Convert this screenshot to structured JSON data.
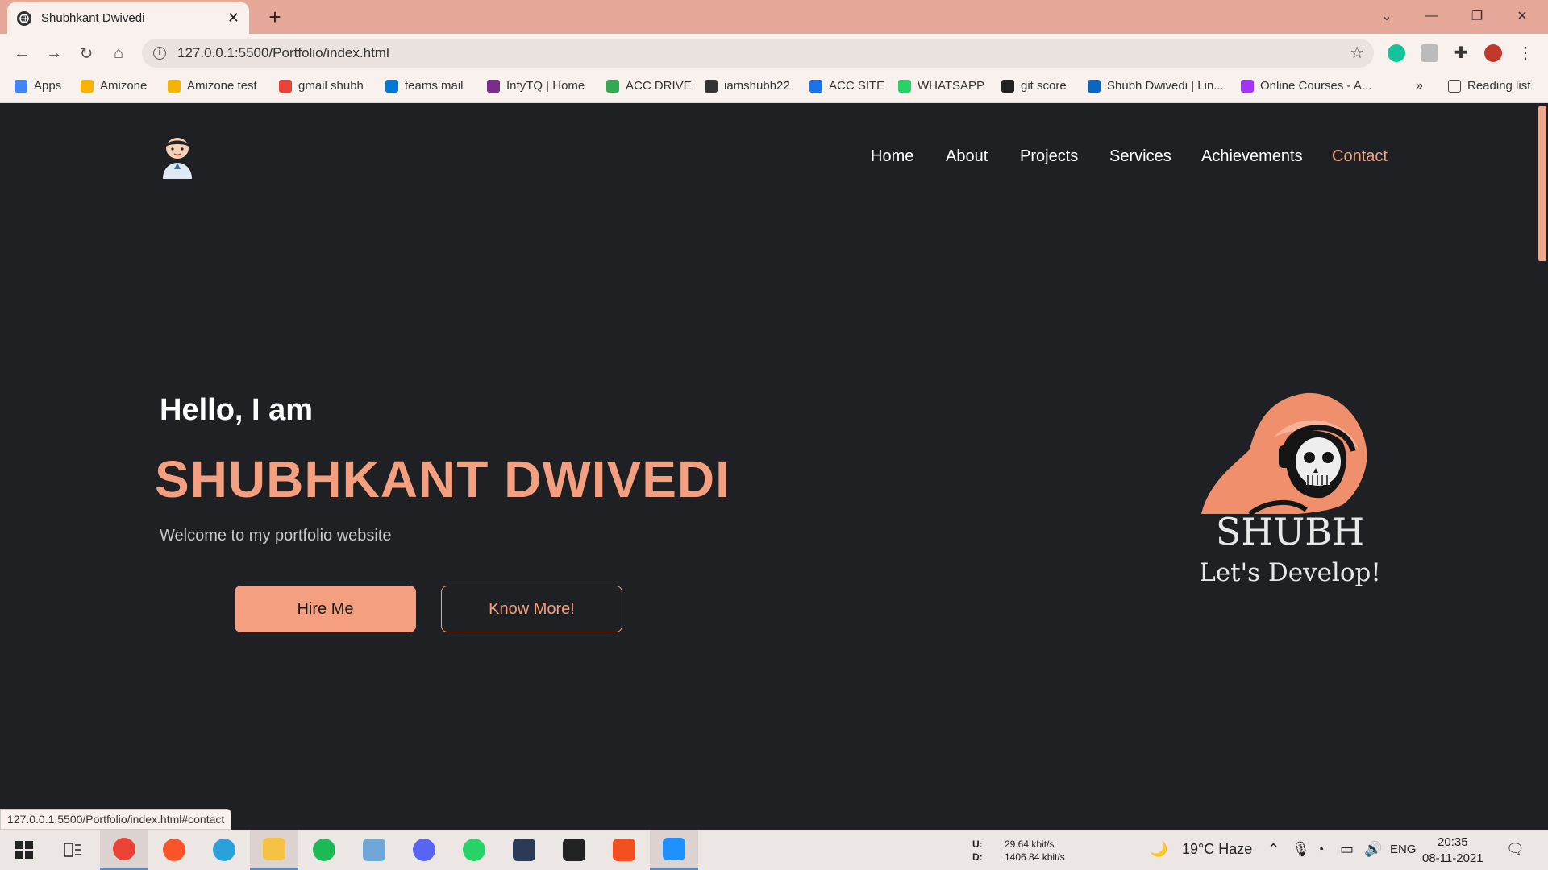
{
  "browser": {
    "tab_title": "Shubhkant Dwivedi",
    "url": "127.0.0.1:5500/Portfolio/index.html",
    "bookmarks": [
      {
        "label": "Apps",
        "icon": "apps-grid-icon",
        "color": "#4285f4"
      },
      {
        "label": "Amizone",
        "icon": "shield-icon",
        "color": "#f4b400"
      },
      {
        "label": "Amizone test",
        "icon": "shield-icon",
        "color": "#f4b400"
      },
      {
        "label": "gmail shubh",
        "icon": "gmail-icon",
        "color": "#ea4335"
      },
      {
        "label": "teams  mail",
        "icon": "outlook-icon",
        "color": "#0078d4"
      },
      {
        "label": "InfyTQ | Home",
        "icon": "infytq-icon",
        "color": "#7b2d8e"
      },
      {
        "label": "ACC DRIVE",
        "icon": "drive-icon",
        "color": "#34a853"
      },
      {
        "label": "iamshubh22",
        "icon": "github-icon",
        "color": "#333333"
      },
      {
        "label": "ACC SITE",
        "icon": "acc-icon",
        "color": "#1a73e8"
      },
      {
        "label": "WHATSAPP",
        "icon": "whatsapp-icon",
        "color": "#25d366"
      },
      {
        "label": "git score",
        "icon": "globe-icon",
        "color": "#222222"
      },
      {
        "label": "Shubh Dwivedi | Lin...",
        "icon": "linkedin-icon",
        "color": "#0a66c2"
      },
      {
        "label": "Online Courses - A...",
        "icon": "udemy-icon",
        "color": "#a435f0"
      }
    ],
    "more_bookmarks": "»",
    "reading_list": "Reading list",
    "status_url": "127.0.0.1:5500/Portfolio/index.html#contact"
  },
  "site": {
    "nav": [
      {
        "label": "Home",
        "active": false
      },
      {
        "label": "About",
        "active": false
      },
      {
        "label": "Projects",
        "active": false
      },
      {
        "label": "Services",
        "active": false
      },
      {
        "label": "Achievements",
        "active": false
      },
      {
        "label": "Contact",
        "active": true
      }
    ],
    "hero": {
      "greeting": "Hello, I am",
      "name": "SHUBHKANT DWIVEDI",
      "tagline": "Welcome to my portfolio website",
      "primary_button": "Hire Me",
      "secondary_button": "Know More!"
    },
    "brand": {
      "title": "SHUBH",
      "subtitle": "Let's Develop!"
    },
    "accent_color": "#f49f7f",
    "background_color": "#1f2024"
  },
  "taskbar": {
    "apps": [
      {
        "name": "chrome",
        "color": "#ea4335",
        "active": true
      },
      {
        "name": "brave",
        "color": "#fb542b",
        "active": false
      },
      {
        "name": "telegram",
        "color": "#2aa1da",
        "active": false
      },
      {
        "name": "file-explorer",
        "color": "#f6c244",
        "active": true
      },
      {
        "name": "spotify",
        "color": "#1db954",
        "active": false
      },
      {
        "name": "notepad",
        "color": "#6fa8d8",
        "active": false
      },
      {
        "name": "discord",
        "color": "#5865f2",
        "active": false
      },
      {
        "name": "whatsapp",
        "color": "#25d366",
        "active": false
      },
      {
        "name": "mysql",
        "color": "#2b3a55",
        "active": false
      },
      {
        "name": "terminal",
        "color": "#222222",
        "active": false
      },
      {
        "name": "figma",
        "color": "#f24e1e",
        "active": false
      },
      {
        "name": "vscode",
        "color": "#1e90ff",
        "active": true
      }
    ],
    "net_up_label": "U:",
    "net_up": "29.64 kbit/s",
    "net_down_label": "D:",
    "net_down": "1406.84 kbit/s",
    "weather": "19°C  Haze",
    "language": "ENG",
    "time": "20:35",
    "date": "08-11-2021"
  }
}
